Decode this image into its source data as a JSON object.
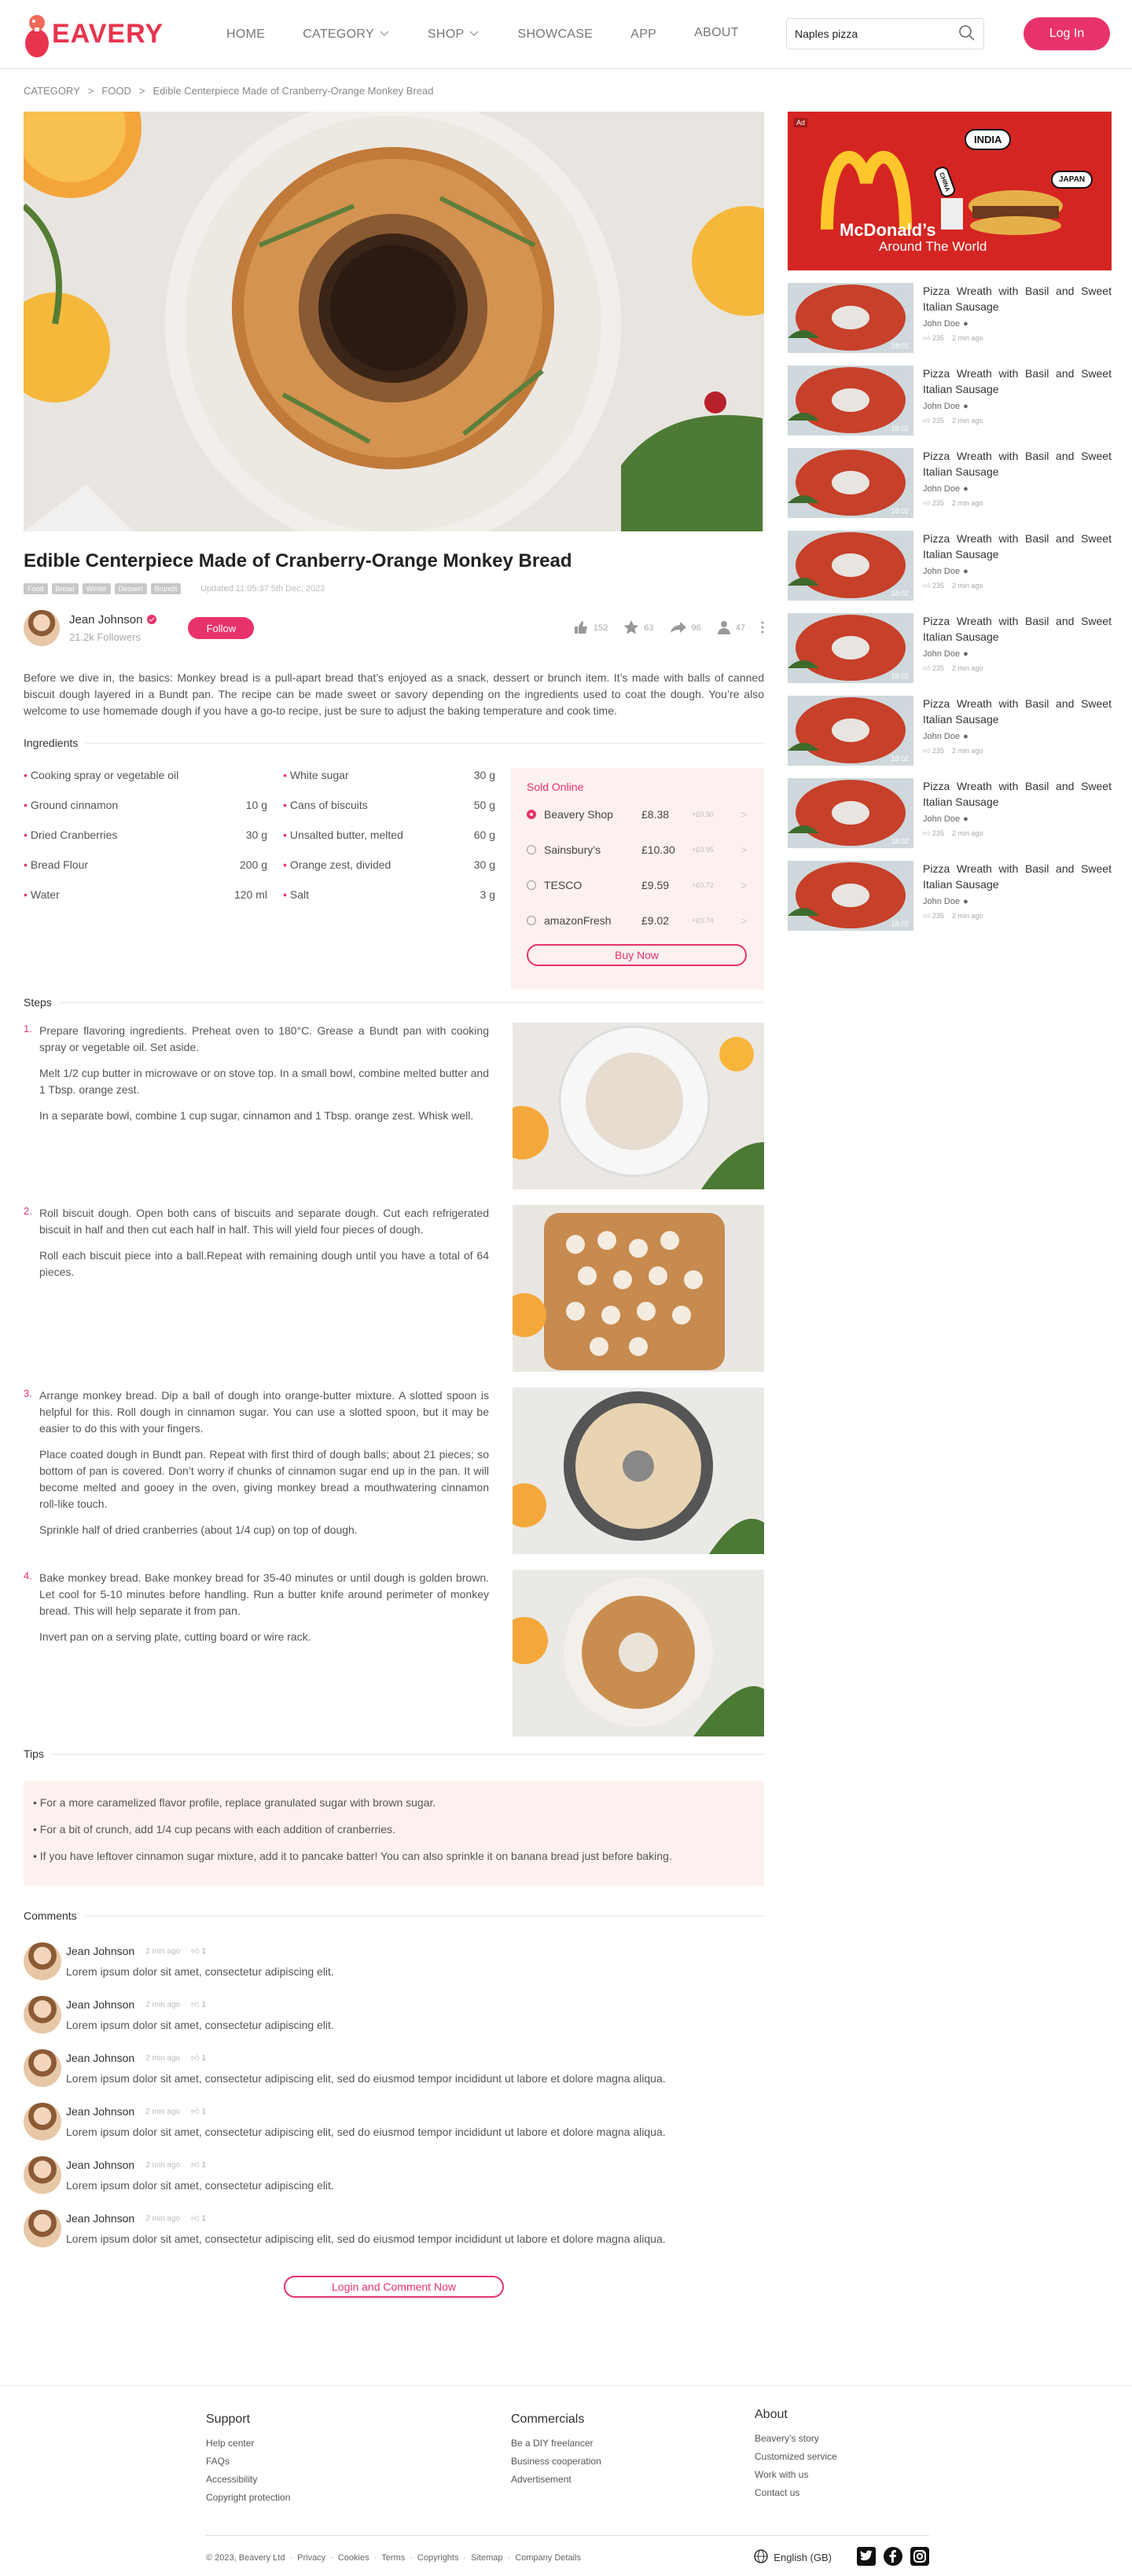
{
  "brand": {
    "name": "EAVERY"
  },
  "nav": [
    "HOME",
    "CATEGORY",
    "SHOP",
    "SHOWCASE",
    "APP",
    "ABOUT"
  ],
  "search": {
    "value": "Naples pizza"
  },
  "login": "Log In",
  "breadcrumb": [
    "CATEGORY",
    "FOOD",
    "Edible Centerpiece Made of Cranberry-Orange Monkey Bread"
  ],
  "article": {
    "title": "Edible Centerpiece Made of Cranberry-Orange Monkey Bread",
    "tags": [
      "Food",
      "Bread",
      "Winter",
      "Dessert",
      "Brunch"
    ],
    "updated": "Updated 11:05:37 5th Dec, 2023",
    "author": "Jean Johnson",
    "followers": "21.2k Followers",
    "follow": "Follow",
    "stats": {
      "likes": "152",
      "stars": "63",
      "shares": "96",
      "views": "47"
    },
    "intro": "Before we dive in, the basics: Monkey bread is a pull-apart bread that’s enjoyed as a snack, dessert or brunch item. It’s made with balls of canned biscuit dough layered in a Bundt pan. The recipe can be made sweet or savory depending on the ingredients used to coat the dough. You’re also welcome to use homemade dough if you have a go-to recipe, just be sure to adjust the baking temperature and cook time."
  },
  "ingredients": {
    "title": "Ingredients",
    "left": [
      {
        "n": "Cooking spray or vegetable oil",
        "q": ""
      },
      {
        "n": "Ground cinnamon",
        "q": "10 g"
      },
      {
        "n": "Dried Cranberries",
        "q": "30 g"
      },
      {
        "n": "Bread Flour",
        "q": "200 g"
      },
      {
        "n": "Water",
        "q": "120 ml"
      }
    ],
    "right": [
      {
        "n": "White sugar",
        "q": "30 g"
      },
      {
        "n": "Cans of biscuits",
        "q": "50 g"
      },
      {
        "n": "Unsalted butter, melted",
        "q": "60 g"
      },
      {
        "n": "Orange zest, divided",
        "q": "30 g"
      },
      {
        "n": "Salt",
        "q": "3 g"
      }
    ]
  },
  "sold": {
    "title": "Sold Online",
    "shops": [
      {
        "name": "Beavery Shop",
        "price": "£8.38",
        "delta": "+£0.30"
      },
      {
        "name": "Sainsbury’s",
        "price": "£10.30",
        "delta": "+£0.95"
      },
      {
        "name": "TESCO",
        "price": "£9.59",
        "delta": "+£0.72"
      },
      {
        "name": "amazonFresh",
        "price": "£9.02",
        "delta": "+£0.74"
      }
    ],
    "buy": "Buy Now"
  },
  "steps": {
    "title": "Steps",
    "items": [
      {
        "num": "1.",
        "paras": [
          "Prepare flavoring ingredients. Preheat oven to 180°C. Grease a Bundt pan with cooking spray or vegetable oil. Set aside.",
          "Melt 1/2 cup butter in microwave or on stove top. In a small bowl, combine melted butter and 1 Tbsp. orange zest.",
          "In a separate bowl, combine 1 cup sugar, cinnamon and 1 Tbsp. orange zest. Whisk well."
        ]
      },
      {
        "num": "2.",
        "paras": [
          "Roll biscuit dough. Open both cans of biscuits and separate dough. Cut each refrigerated biscuit in half and then cut each half in half. This will yield four pieces of dough.",
          "Roll each biscuit piece into a ball.Repeat with remaining dough until you have a total of 64 pieces."
        ]
      },
      {
        "num": "3.",
        "paras": [
          "Arrange monkey bread. Dip a ball of dough into orange-butter mixture. A slotted spoon is helpful for this. Roll dough in cinnamon sugar. You can use a slotted spoon, but it may be easier to do this with your fingers.",
          "Place coated dough in Bundt pan. Repeat with first third of dough balls; about 21 pieces; so bottom of pan is covered. Don’t worry if chunks of cinnamon sugar end up in the pan. It will become melted and gooey in the oven, giving monkey bread a mouthwatering cinnamon roll-like touch.",
          "Sprinkle half of dried cranberries (about 1/4 cup) on top of dough."
        ]
      },
      {
        "num": "4.",
        "paras": [
          "Bake monkey bread. Bake monkey bread for 35-40 minutes or until dough is golden brown. Let cool for 5-10 minutes before handling. Run a butter knife around perimeter of monkey bread. This will help separate it from pan.",
          "Invert pan on a serving plate, cutting board or wire rack."
        ]
      }
    ]
  },
  "tips": {
    "title": "Tips",
    "items": [
      "• For a more caramelized flavor profile, replace granulated sugar with brown sugar.",
      "• For a bit of crunch, add 1/4 cup pecans with each addition of cranberries.",
      "• If you have leftover cinnamon sugar mixture, add it to pancake batter! You can also sprinkle it on banana bread just before baking."
    ]
  },
  "comments": {
    "title": "Comments",
    "items": [
      {
        "name": "Jean Johnson",
        "time": "2 min ago",
        "likes": "1",
        "text": "Lorem ipsum dolor sit amet, consectetur adipiscing elit."
      },
      {
        "name": "Jean Johnson",
        "time": "2 min ago",
        "likes": "1",
        "text": "Lorem ipsum dolor sit amet, consectetur adipiscing elit."
      },
      {
        "name": "Jean Johnson",
        "time": "2 min ago",
        "likes": "1",
        "text": "Lorem ipsum dolor sit amet, consectetur adipiscing elit, sed do eiusmod tempor incididunt ut labore et dolore magna aliqua."
      },
      {
        "name": "Jean Johnson",
        "time": "2 min ago",
        "likes": "1",
        "text": "Lorem ipsum dolor sit amet, consectetur adipiscing elit, sed do eiusmod tempor incididunt ut labore et dolore magna aliqua."
      },
      {
        "name": "Jean Johnson",
        "time": "2 min ago",
        "likes": "1",
        "text": "Lorem ipsum dolor sit amet, consectetur adipiscing elit."
      },
      {
        "name": "Jean Johnson",
        "time": "2 min ago",
        "likes": "1",
        "text": "Lorem ipsum dolor sit amet, consectetur adipiscing elit, sed do eiusmod tempor incididunt ut labore et dolore magna aliqua."
      }
    ],
    "login": "Login and Comment Now"
  },
  "ad": {
    "label": "Ad",
    "brand": "McDonald’s",
    "tagline": "Around The World",
    "bubbles": [
      "INDIA",
      "JAPAN",
      "CHINA"
    ]
  },
  "sidebar": {
    "cards": [
      {
        "title": "Pizza Wreath with Basil and Sweet Italian Sausage",
        "author": "John Doe",
        "likes": "235",
        "time": "2 min ago",
        "duration": "18:02"
      },
      {
        "title": "Pizza Wreath with Basil and Sweet Italian Sausage",
        "author": "John Doe",
        "likes": "235",
        "time": "2 min ago",
        "duration": "18:02"
      },
      {
        "title": "Pizza Wreath with Basil and Sweet Italian Sausage",
        "author": "John Doe",
        "likes": "235",
        "time": "2 min ago",
        "duration": "18:02"
      },
      {
        "title": "Pizza Wreath with Basil and Sweet Italian Sausage",
        "author": "John Doe",
        "likes": "235",
        "time": "2 min ago",
        "duration": "18:02"
      },
      {
        "title": "Pizza Wreath with Basil and Sweet Italian Sausage",
        "author": "John Doe",
        "likes": "235",
        "time": "2 min ago",
        "duration": "18:02"
      },
      {
        "title": "Pizza Wreath with Basil and Sweet Italian Sausage",
        "author": "John Doe",
        "likes": "235",
        "time": "2 min ago",
        "duration": "18:02"
      },
      {
        "title": "Pizza Wreath with Basil and Sweet Italian Sausage",
        "author": "John Doe",
        "likes": "235",
        "time": "2 min ago",
        "duration": "18:02"
      },
      {
        "title": "Pizza Wreath with Basil and Sweet Italian Sausage",
        "author": "John Doe",
        "likes": "235",
        "time": "2 min ago",
        "duration": "18:02"
      }
    ]
  },
  "footer": {
    "support": {
      "title": "Support",
      "links": [
        "Help center",
        "FAQs",
        "Accessibility",
        "Copyright protection"
      ]
    },
    "commercials": {
      "title": "Commercials",
      "links": [
        "Be a DIY freelancer",
        "Business cooperation",
        "Advertisement"
      ]
    },
    "about": {
      "title": "About",
      "links": [
        "Beavery’s story",
        "Customized service",
        "Work with us",
        "Contact us"
      ]
    },
    "copyright": "© 2023, Beavery Ltd",
    "legal": [
      "Privacy",
      "Cookies",
      "Terms",
      "Copyrights",
      "Sitemap",
      "Company Details"
    ],
    "language": "English (GB)"
  },
  "colors": {
    "accent": "#e8336a",
    "brand": "#e8344e",
    "tint": "#fdf1ef"
  }
}
